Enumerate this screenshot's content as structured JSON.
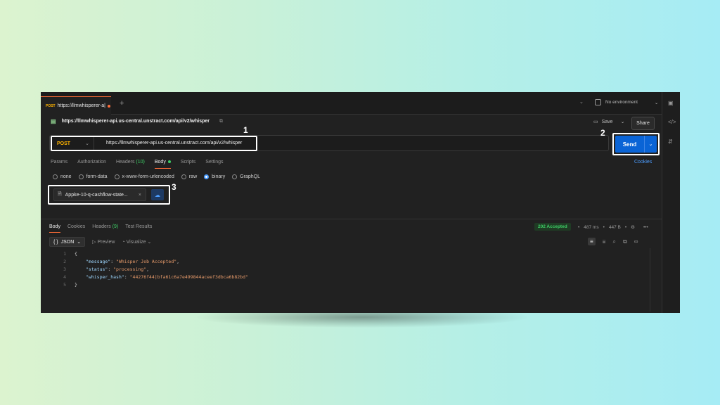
{
  "tabbar": {
    "tab_method": "POST",
    "tab_url": "https://llmwhisperer-a|",
    "plus": "+",
    "environment": "No environment"
  },
  "request": {
    "title_url": "https://llmwhisperer-api.us-central.unstract.com/api/v2/whisper",
    "save_label": "Save",
    "share_label": "Share",
    "method": "POST",
    "url": "https://llmwhisperer-api.us-central.unstract.com/api/v2/whisper",
    "send_label": "Send"
  },
  "annotations": {
    "n1": "1",
    "n2": "2",
    "n3": "3"
  },
  "request_tabs": [
    {
      "label": "Params"
    },
    {
      "label": "Authorization"
    },
    {
      "label": "Headers",
      "count": "(10)"
    },
    {
      "label": "Body"
    },
    {
      "label": "Scripts"
    },
    {
      "label": "Settings"
    }
  ],
  "cookies_label": "Cookies",
  "body_types": [
    {
      "label": "none",
      "selected": false
    },
    {
      "label": "form-data",
      "selected": false
    },
    {
      "label": "x-www-form-urlencoded",
      "selected": false
    },
    {
      "label": "raw",
      "selected": false
    },
    {
      "label": "binary",
      "selected": true
    },
    {
      "label": "GraphQL",
      "selected": false
    }
  ],
  "file": {
    "name": "Appke-10-q-cashflow-state...",
    "remove": "×"
  },
  "response": {
    "tabs": [
      {
        "label": "Body"
      },
      {
        "label": "Cookies"
      },
      {
        "label": "Headers",
        "count": "(9)"
      },
      {
        "label": "Test Results"
      }
    ],
    "status": "202 Accepted",
    "time": "487 ms",
    "size": "447 B",
    "format": "JSON",
    "preview_label": "Preview",
    "visualize_label": "Visualize",
    "lines": [
      {
        "n": "1",
        "open": "{"
      },
      {
        "n": "2",
        "key": "\"message\"",
        "value": "\"Whisper Job Accepted\"",
        "comma": ","
      },
      {
        "n": "3",
        "key": "\"status\"",
        "value": "\"processing\"",
        "comma": ","
      },
      {
        "n": "4",
        "key": "\"whisper_hash\"",
        "value": "\"44276f44|bfa61c6a7e499844aceef3dbca6b82bd\"",
        "comma": ""
      },
      {
        "n": "5",
        "close": "}"
      }
    ]
  },
  "colors": {
    "accent_orange": "#ff6c37",
    "send_blue": "#0a64d6",
    "method_yellow": "#ffb400",
    "status_green": "#3ecf66"
  }
}
